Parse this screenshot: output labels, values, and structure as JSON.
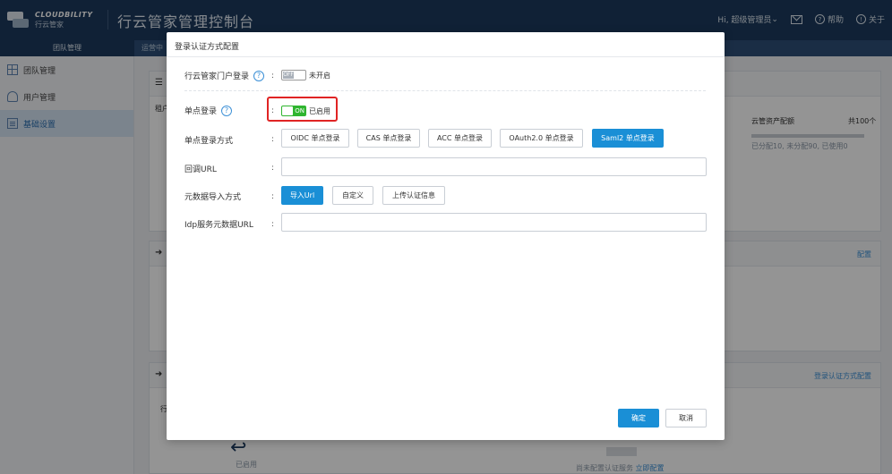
{
  "header": {
    "logo_en": "CLOUDBILITY",
    "logo_cn": "行云管家",
    "title": "行云管家管理控制台",
    "user": "Hi, 超级管理员",
    "help": "帮助",
    "about": "关于"
  },
  "subnav": {
    "tab1": "团队管理",
    "tab2": "运营中"
  },
  "sidebar": {
    "items": [
      {
        "label": "团队管理",
        "icon": "grid-icon"
      },
      {
        "label": "用户管理",
        "icon": "users-icon"
      },
      {
        "label": "基础设置",
        "icon": "doc-icon"
      }
    ]
  },
  "background": {
    "tenant_label": "租户",
    "quota_label": "云管资产配额",
    "quota_total": "共100个",
    "quota_detail": "已分配10, 未分配90, 已使用0",
    "config_link": "配置",
    "login_config_link": "登录认证方式配置",
    "row_prefix": "行",
    "enabled_text": "已启用",
    "no_auth_text": "尚未配置认证服务",
    "configure_now": "立即配置"
  },
  "modal": {
    "title": "登录认证方式配置",
    "colon": ":",
    "portal_label": "行云管家门户登录",
    "portal_switch": "OFF",
    "portal_status": "未开启",
    "sso_label": "单点登录",
    "sso_switch": "ON",
    "sso_status": "已启用",
    "sso_method_label": "单点登录方式",
    "sso_methods": [
      "OIDC 单点登录",
      "CAS 单点登录",
      "ACC 单点登录",
      "OAuth2.0 单点登录",
      "Saml2 单点登录"
    ],
    "callback_label": "回调URL",
    "callback_value": "",
    "import_label": "元数据导入方式",
    "import_methods": [
      "导入Url",
      "自定义",
      "上传认证信息"
    ],
    "idp_label": "Idp服务元数据URL",
    "idp_value": "",
    "confirm": "确定",
    "cancel": "取消"
  },
  "colors": {
    "header": "#1c3a5e",
    "primary": "#1a8fd6",
    "switch_on": "#2fb52f",
    "highlight": "#e02424"
  }
}
